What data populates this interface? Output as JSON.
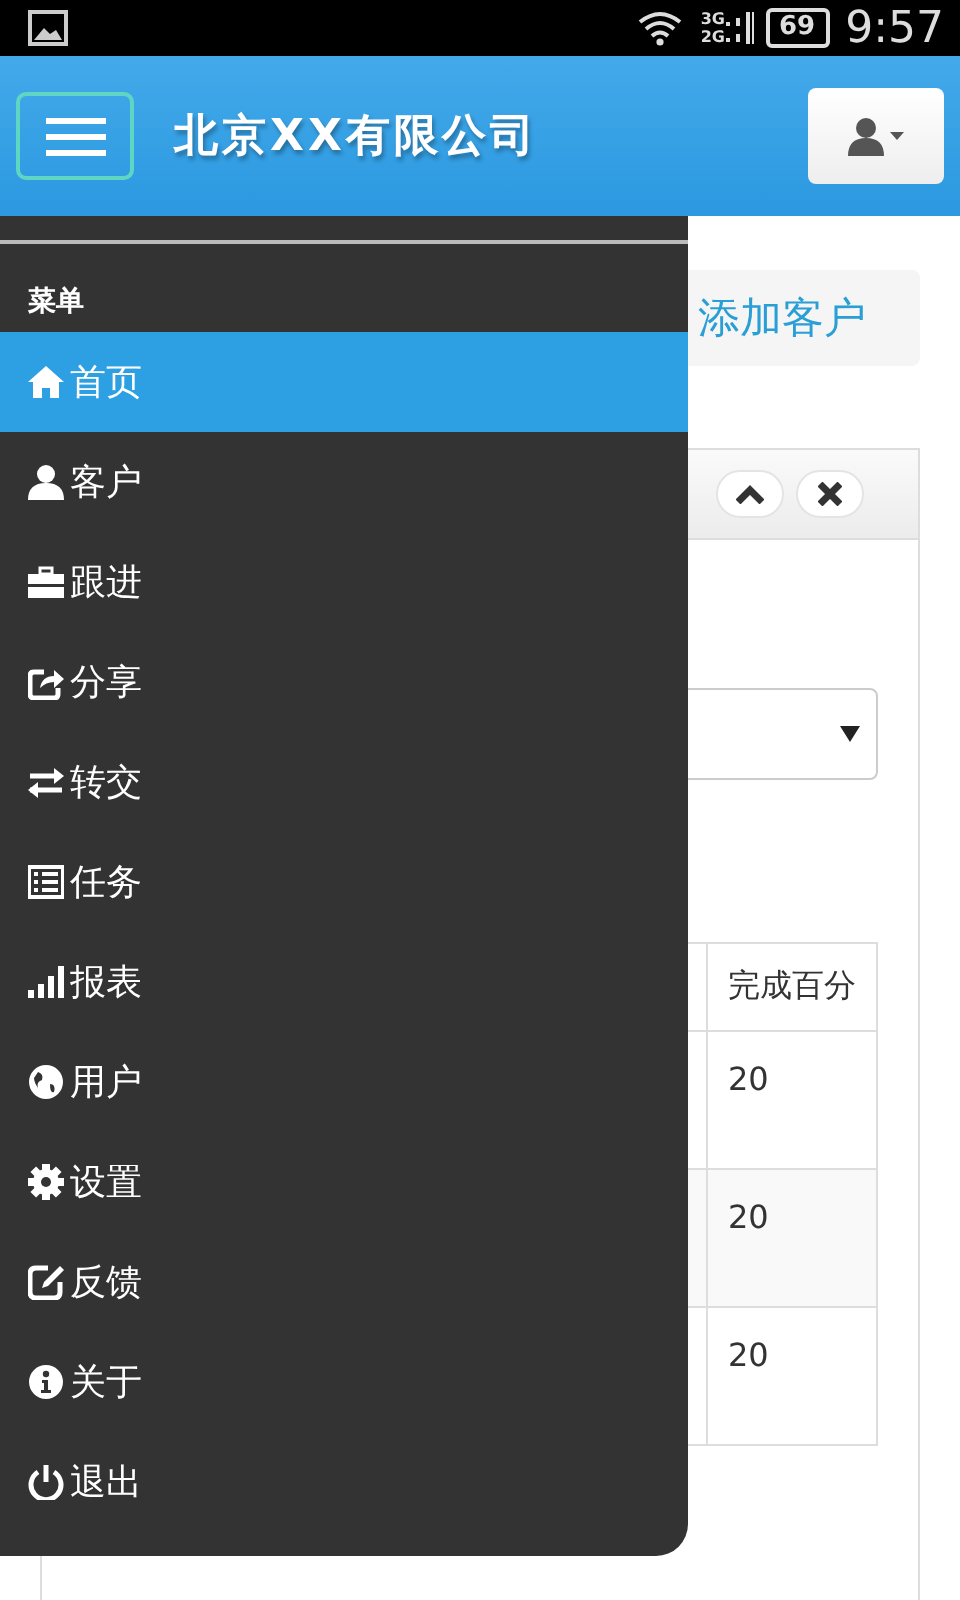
{
  "status_bar": {
    "network_top": "3G",
    "network_bottom": "2G",
    "battery": "69",
    "time": "9:57"
  },
  "header": {
    "title": "北京XX有限公司"
  },
  "breadcrumb": {
    "action": "添加客户"
  },
  "table": {
    "columns": [
      "完成百分"
    ],
    "rows": [
      [
        "20"
      ],
      [
        "20"
      ],
      [
        "20"
      ]
    ]
  },
  "menu": {
    "heading": "菜单",
    "items": [
      {
        "label": "首页",
        "selected": true
      },
      {
        "label": "客户",
        "selected": false
      },
      {
        "label": "跟进",
        "selected": false
      },
      {
        "label": "分享",
        "selected": false
      },
      {
        "label": "转交",
        "selected": false
      },
      {
        "label": "任务",
        "selected": false
      },
      {
        "label": "报表",
        "selected": false
      },
      {
        "label": "用户",
        "selected": false
      },
      {
        "label": "设置",
        "selected": false
      },
      {
        "label": "反馈",
        "selected": false
      },
      {
        "label": "关于",
        "selected": false
      },
      {
        "label": "退出",
        "selected": false
      }
    ]
  }
}
